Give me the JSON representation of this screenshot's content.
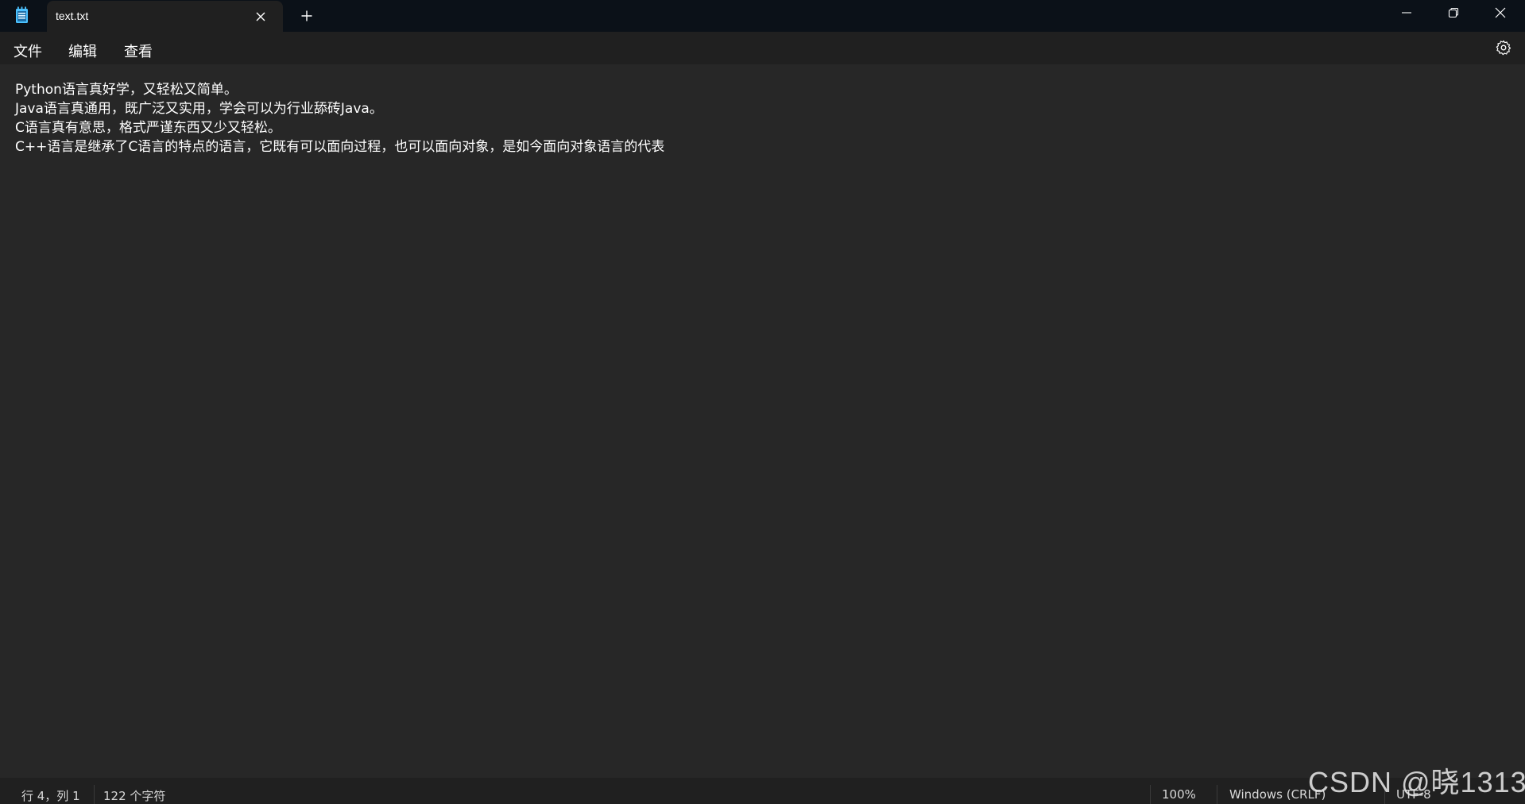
{
  "tab": {
    "title": "text.txt"
  },
  "menu": {
    "file": "文件",
    "edit": "编辑",
    "view": "查看"
  },
  "editor": {
    "lines": [
      "Python语言真好学，又轻松又简单。",
      "Java语言真通用，既广泛又实用，学会可以为行业舔砖Java。",
      "C语言真有意思，格式严谨东西又少又轻松。",
      "C++语言是继承了C语言的特点的语言，它既有可以面向过程，也可以面向对象，是如今面向对象语言的代表"
    ]
  },
  "status": {
    "position": "行 4，列 1",
    "char_count": "122 个字符",
    "zoom": "100%",
    "line_ending": "Windows (CRLF)",
    "encoding": "UTF-8"
  },
  "watermark": "CSDN @晓1313",
  "icons": {
    "app": "notepad-icon",
    "close_tab": "close-icon",
    "new_tab": "plus-icon",
    "minimize": "minimize-icon",
    "maximize": "restore-icon",
    "close_window": "close-icon",
    "settings": "gear-icon"
  },
  "colors": {
    "titlebar": "#0b1118",
    "menubar": "#202020",
    "editor": "#272727",
    "accent": "#4cc2ff"
  }
}
